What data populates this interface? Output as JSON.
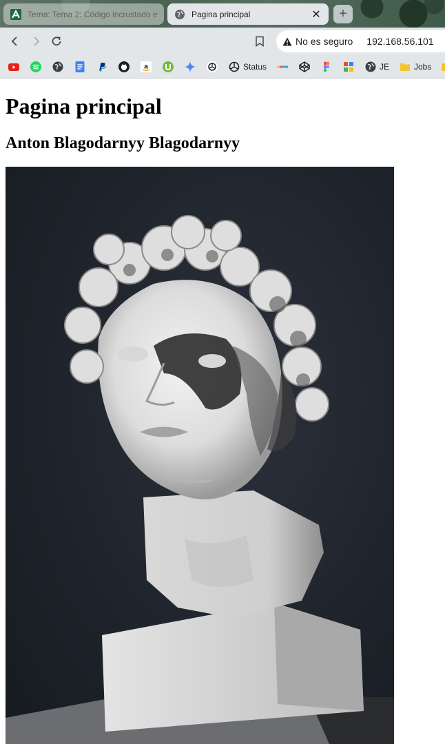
{
  "browser": {
    "tabs": [
      {
        "title": "Tema: Tema 2: Código incrustado e",
        "icon": "moodle-icon",
        "active": false
      },
      {
        "title": "Pagina principal",
        "icon": "globe-icon",
        "active": true
      }
    ],
    "address_bar": {
      "security_label": "No es seguro",
      "url": "192.168.56.101"
    },
    "bookmarks": [
      {
        "icon": "youtube-icon",
        "label": ""
      },
      {
        "icon": "spotify-icon",
        "label": ""
      },
      {
        "icon": "globe-icon",
        "label": ""
      },
      {
        "icon": "google-docs-icon",
        "label": ""
      },
      {
        "icon": "paypal-icon",
        "label": ""
      },
      {
        "icon": "github-icon",
        "label": ""
      },
      {
        "icon": "amazon-icon",
        "label": ""
      },
      {
        "icon": "utorrent-icon",
        "label": ""
      },
      {
        "icon": "gemini-icon",
        "label": ""
      },
      {
        "icon": "openai-icon",
        "label": ""
      },
      {
        "icon": "openai-status-icon",
        "label": "Status"
      },
      {
        "icon": "colorful-bar-icon",
        "label": ""
      },
      {
        "icon": "codepen-icon",
        "label": ""
      },
      {
        "icon": "figma-icon",
        "label": ""
      },
      {
        "icon": "blocks-icon",
        "label": ""
      },
      {
        "icon": "globe-icon",
        "label": "JE"
      },
      {
        "icon": "folder-icon",
        "label": "Jobs"
      }
    ]
  },
  "page": {
    "heading": "Pagina principal",
    "subheading": "Anton Blagodarnyy Blagodarnyy",
    "image_subject": "marble-bust-photo"
  },
  "colors": {
    "tab_bar_bg": "#e3e6e9",
    "photo_bg": "#1f242c",
    "marble": "#e6e6e6"
  }
}
